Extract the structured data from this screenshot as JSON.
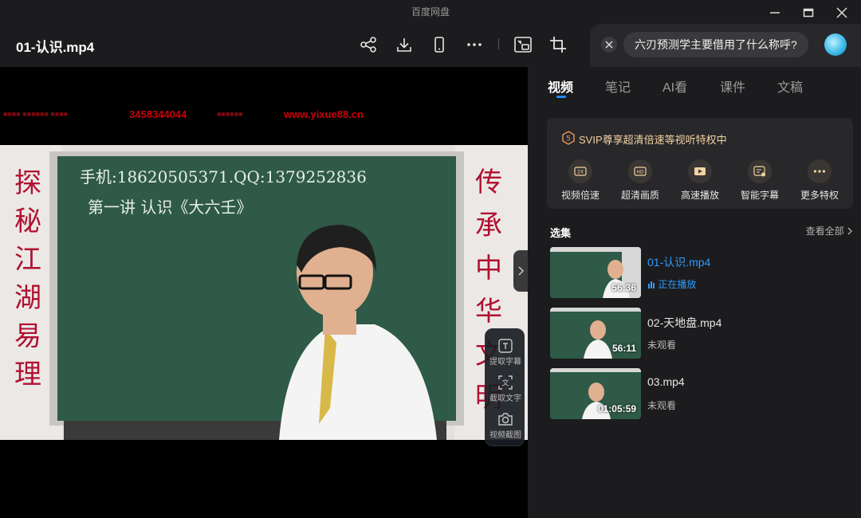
{
  "window": {
    "app_title": "百度网盘",
    "controls": [
      "minimize-icon",
      "maximize-icon",
      "close-icon"
    ]
  },
  "header": {
    "file_title": "01-认识.mp4",
    "toolbar_icons": [
      "share-icon",
      "download-icon",
      "phone-icon",
      "more-icon",
      "pip-icon",
      "crop-icon"
    ]
  },
  "ai_assistant": {
    "question": "六刃预测学主要借用了什么称呼?"
  },
  "video": {
    "watermark_phone": "3458344044",
    "watermark_url": "www.yixue88.cn",
    "board_line1": "手机:18620505371.QQ:1379252836",
    "board_line2": "第一讲 认识《大六壬》",
    "banner_left": [
      "探",
      "秘",
      "江",
      "湖",
      "易",
      "理"
    ],
    "banner_right": [
      "传",
      "承",
      "中",
      "华",
      "文",
      "明"
    ]
  },
  "tools": [
    {
      "label": "提取字幕",
      "icon": "subtitle-extract-icon"
    },
    {
      "label": "截取文字",
      "icon": "text-capture-icon"
    },
    {
      "label": "视频截图",
      "icon": "camera-icon"
    }
  ],
  "sidebar": {
    "tabs": [
      "视频",
      "笔记",
      "AI看",
      "课件",
      "文稿"
    ],
    "active_tab": "视频",
    "svip": {
      "title": "SVIP尊享超清倍速等视听特权中",
      "features": [
        {
          "label": "视频倍速",
          "icon": "speed-icon"
        },
        {
          "label": "超清画质",
          "icon": "hd-icon"
        },
        {
          "label": "高速播放",
          "icon": "play-fast-icon"
        },
        {
          "label": "智能字幕",
          "icon": "smart-subtitle-icon"
        },
        {
          "label": "更多特权",
          "icon": "more-icon"
        }
      ]
    },
    "playlist": {
      "title": "选集",
      "view_all": "查看全部",
      "episodes": [
        {
          "name": "01-认识.mp4",
          "duration": "56:36",
          "status": "正在播放",
          "playing": true
        },
        {
          "name": "02-天地盘.mp4",
          "duration": "56:11",
          "status": "未观看",
          "playing": false
        },
        {
          "name": "03.mp4",
          "duration": "01:05:59",
          "status": "未观看",
          "playing": false
        }
      ]
    }
  },
  "colors": {
    "accent": "#2f9bff",
    "svip_gold": "#f2d3a2",
    "chalkboard": "#2f5a48",
    "banner_red": "#b01030"
  }
}
